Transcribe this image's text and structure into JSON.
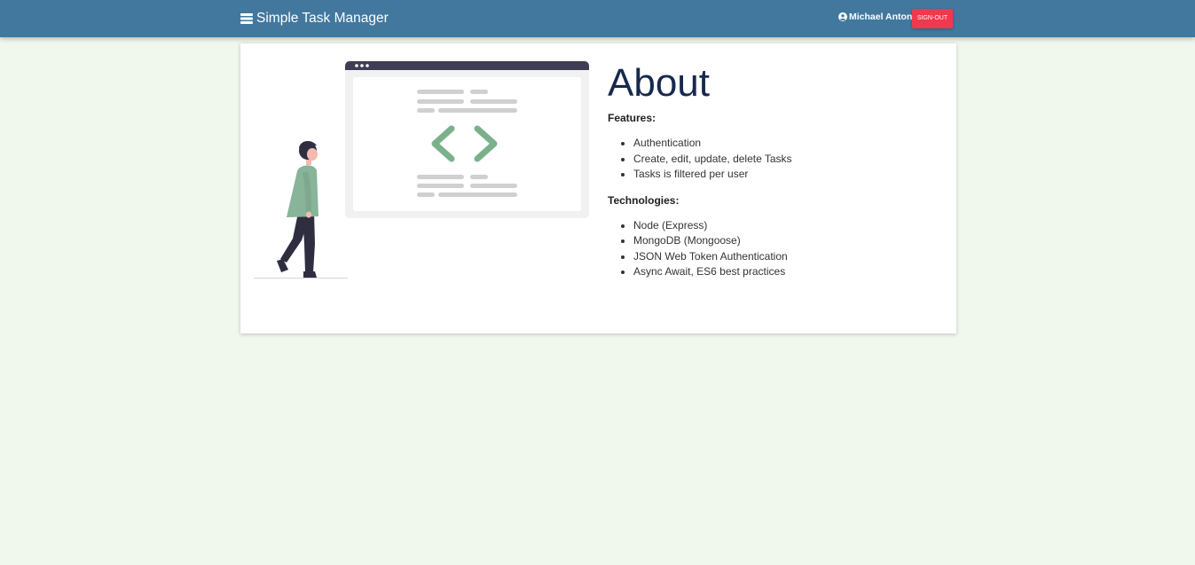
{
  "navbar": {
    "brand_icon": "menu-icon",
    "brand_label": "Simple Task Manager",
    "user_icon": "user-circle-icon",
    "user_name": "Michael Antoni",
    "signout_label": "SIGN-OUT",
    "background_color": "#42789d",
    "signout_color": "#f3374f"
  },
  "page": {
    "background_color": "#f0f8ee"
  },
  "about": {
    "title": "About",
    "illustration": "developer-code-window-illustration",
    "features": {
      "heading": "Features:",
      "items": [
        "Authentication",
        "Create, edit, update, delete Tasks",
        "Tasks is filtered per user"
      ]
    },
    "technologies": {
      "heading": "Technologies:",
      "items": [
        "Node (Express)",
        "MongoDB (Mongoose)",
        "JSON Web Token Authentication",
        "Async Await, ES6 best practices"
      ]
    }
  }
}
